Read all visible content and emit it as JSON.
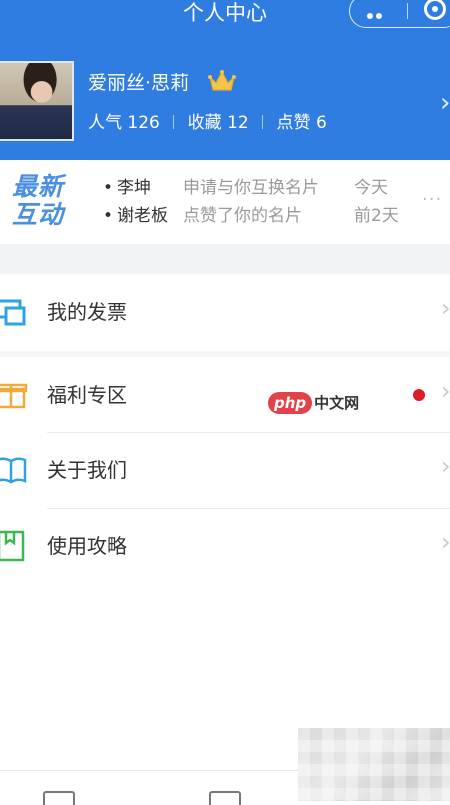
{
  "nav": {
    "title": "个人中心"
  },
  "profile": {
    "name": "爱丽丝·思莉",
    "stats": [
      {
        "label": "人气",
        "value": "126"
      },
      {
        "label": "收藏",
        "value": "12"
      },
      {
        "label": "点赞",
        "value": "6"
      }
    ],
    "chevron": "›"
  },
  "interactions": {
    "badge_line1": "最新",
    "badge_line2": "互动",
    "items": [
      {
        "who": "李坤",
        "action": "申请与你互换名片",
        "time": "今天"
      },
      {
        "who": "谢老板",
        "action": "点赞了你的名片",
        "time": "前2天"
      }
    ],
    "more": "···"
  },
  "menu": [
    {
      "label": "我的发票",
      "icon": "invoice-icon"
    },
    {
      "label": "福利专区",
      "icon": "gift-icon",
      "dot": true
    },
    {
      "label": "关于我们",
      "icon": "book-icon"
    },
    {
      "label": "使用攻略",
      "icon": "guide-icon"
    }
  ],
  "watermark": {
    "badge": "php",
    "text": "中文网"
  },
  "colors": {
    "primary": "#2f7de1",
    "badge": "#4a8fe0",
    "dot": "#d81e26"
  }
}
